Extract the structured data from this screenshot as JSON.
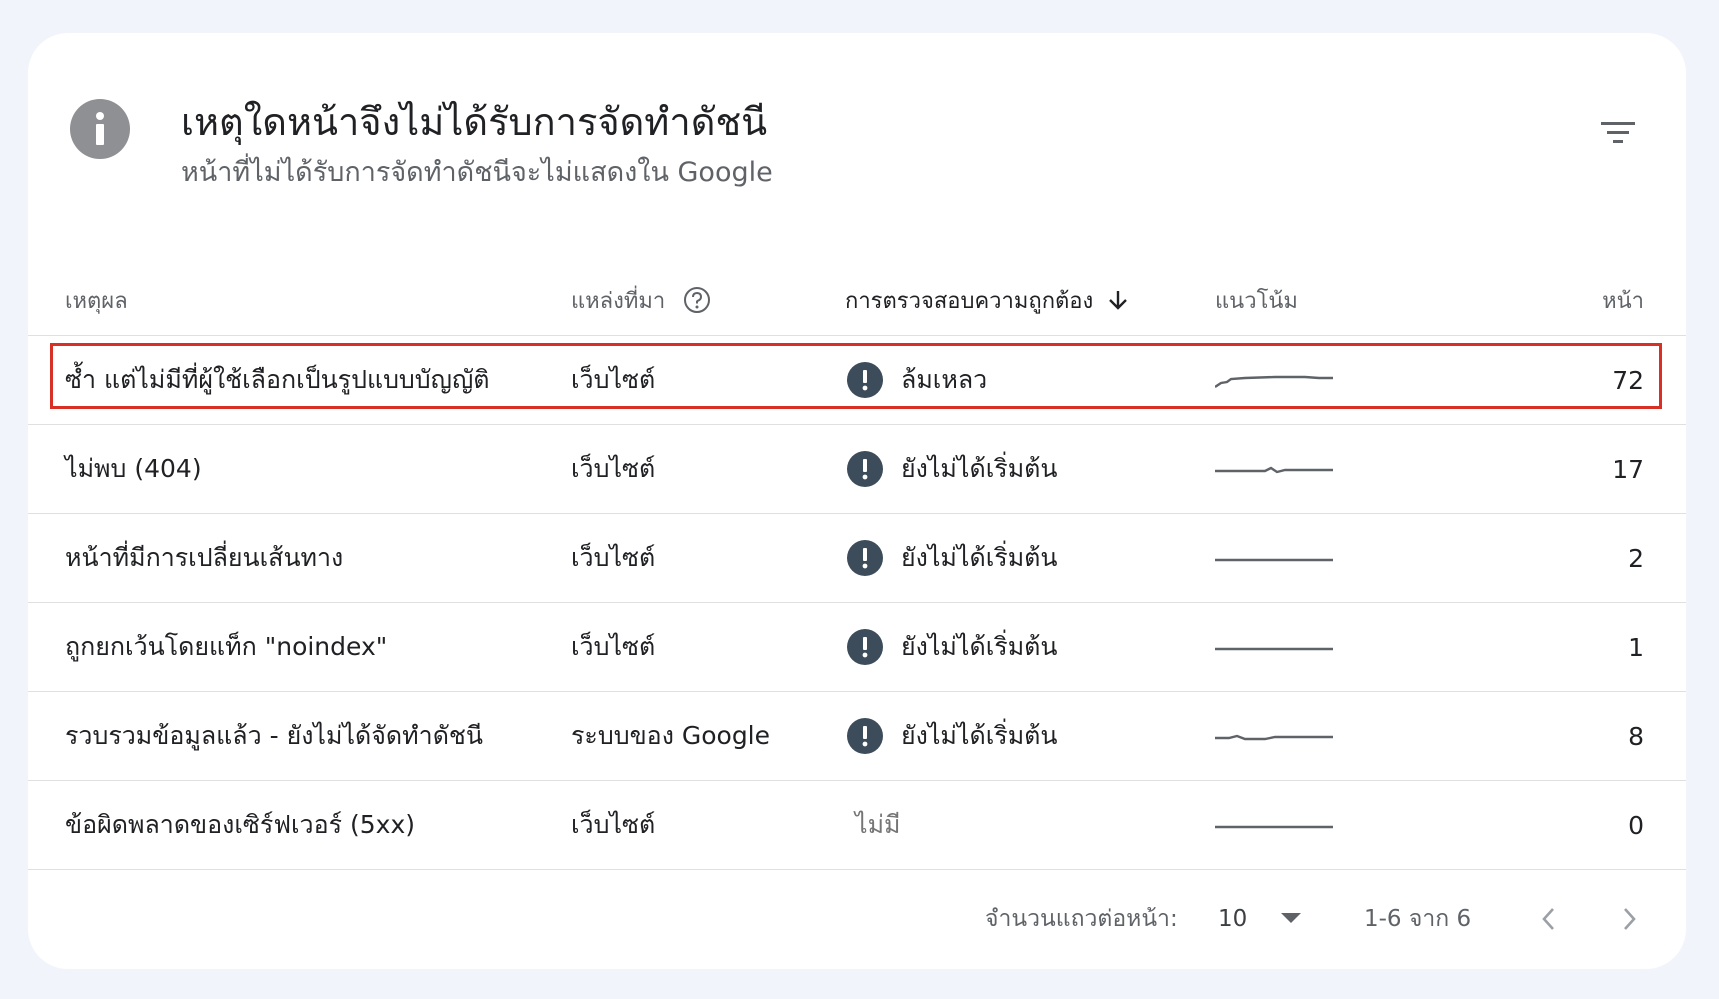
{
  "header": {
    "title": "เหตุใดหน้าจึงไม่ได้รับการจัดทำดัชนี",
    "subtitle": "หน้าที่ไม่ได้รับการจัดทำดัชนีจะไม่แสดงใน Google"
  },
  "table": {
    "columns": {
      "reason": "เหตุผล",
      "source": "แหล่งที่มา",
      "validation": "การตรวจสอบความถูกต้อง",
      "trend": "แนวโน้ม",
      "pages": "หน้า"
    },
    "rows": [
      {
        "reason": "ซ้ำ แต่ไม่มีที่ผู้ใช้เลือกเป็นรูปแบบบัญญัติ",
        "source": "เว็บไซต์",
        "validation": "ล้มเหลว",
        "pages": "72",
        "has_status_icon": true,
        "highlighted": true
      },
      {
        "reason": "ไม่พบ (404)",
        "source": "เว็บไซต์",
        "validation": "ยังไม่ได้เริ่มต้น",
        "pages": "17",
        "has_status_icon": true
      },
      {
        "reason": "หน้าที่มีการเปลี่ยนเส้นทาง",
        "source": "เว็บไซต์",
        "validation": "ยังไม่ได้เริ่มต้น",
        "pages": "2",
        "has_status_icon": true
      },
      {
        "reason": "ถูกยกเว้นโดยแท็ก \"noindex\"",
        "source": "เว็บไซต์",
        "validation": "ยังไม่ได้เริ่มต้น",
        "pages": "1",
        "has_status_icon": true
      },
      {
        "reason": "รวบรวมข้อมูลแล้ว - ยังไม่ได้จัดทำดัชนี",
        "source": "ระบบของ Google",
        "validation": "ยังไม่ได้เริ่มต้น",
        "pages": "8",
        "has_status_icon": true
      },
      {
        "reason": "ข้อผิดพลาดของเซิร์ฟเวอร์ (5xx)",
        "source": "เว็บไซต์",
        "validation": "ไม่มี",
        "pages": "0",
        "has_status_icon": false
      }
    ]
  },
  "pagination": {
    "rows_per_page_label": "จำนวนแถวต่อหน้า:",
    "rows_per_page": "10",
    "range": "1-6 จาก 6"
  },
  "icons": {
    "header": "info-icon",
    "filter": "filter-icon",
    "source_help": "help-circle-icon",
    "sort": "arrow-down-icon",
    "status": "exclamation-icon",
    "rows_dropdown": "caret-down-icon",
    "prev": "chevron-left-icon",
    "next": "chevron-right-icon"
  },
  "colors": {
    "status_icon": "#3c4c5a",
    "highlight_border": "#d93025",
    "trend_line": "#5f6368"
  }
}
